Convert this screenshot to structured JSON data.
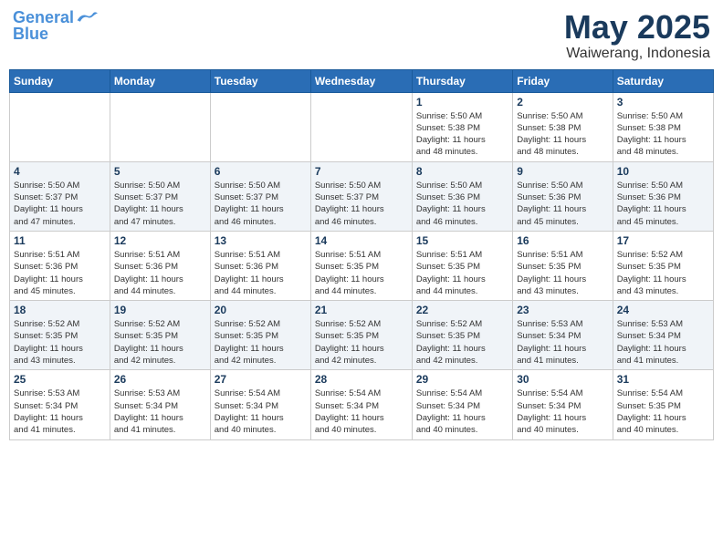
{
  "header": {
    "logo_line1": "General",
    "logo_line2": "Blue",
    "month": "May 2025",
    "location": "Waiwerang, Indonesia"
  },
  "weekdays": [
    "Sunday",
    "Monday",
    "Tuesday",
    "Wednesday",
    "Thursday",
    "Friday",
    "Saturday"
  ],
  "weeks": [
    [
      {
        "day": "",
        "info": ""
      },
      {
        "day": "",
        "info": ""
      },
      {
        "day": "",
        "info": ""
      },
      {
        "day": "",
        "info": ""
      },
      {
        "day": "1",
        "info": "Sunrise: 5:50 AM\nSunset: 5:38 PM\nDaylight: 11 hours\nand 48 minutes."
      },
      {
        "day": "2",
        "info": "Sunrise: 5:50 AM\nSunset: 5:38 PM\nDaylight: 11 hours\nand 48 minutes."
      },
      {
        "day": "3",
        "info": "Sunrise: 5:50 AM\nSunset: 5:38 PM\nDaylight: 11 hours\nand 48 minutes."
      }
    ],
    [
      {
        "day": "4",
        "info": "Sunrise: 5:50 AM\nSunset: 5:37 PM\nDaylight: 11 hours\nand 47 minutes."
      },
      {
        "day": "5",
        "info": "Sunrise: 5:50 AM\nSunset: 5:37 PM\nDaylight: 11 hours\nand 47 minutes."
      },
      {
        "day": "6",
        "info": "Sunrise: 5:50 AM\nSunset: 5:37 PM\nDaylight: 11 hours\nand 46 minutes."
      },
      {
        "day": "7",
        "info": "Sunrise: 5:50 AM\nSunset: 5:37 PM\nDaylight: 11 hours\nand 46 minutes."
      },
      {
        "day": "8",
        "info": "Sunrise: 5:50 AM\nSunset: 5:36 PM\nDaylight: 11 hours\nand 46 minutes."
      },
      {
        "day": "9",
        "info": "Sunrise: 5:50 AM\nSunset: 5:36 PM\nDaylight: 11 hours\nand 45 minutes."
      },
      {
        "day": "10",
        "info": "Sunrise: 5:50 AM\nSunset: 5:36 PM\nDaylight: 11 hours\nand 45 minutes."
      }
    ],
    [
      {
        "day": "11",
        "info": "Sunrise: 5:51 AM\nSunset: 5:36 PM\nDaylight: 11 hours\nand 45 minutes."
      },
      {
        "day": "12",
        "info": "Sunrise: 5:51 AM\nSunset: 5:36 PM\nDaylight: 11 hours\nand 44 minutes."
      },
      {
        "day": "13",
        "info": "Sunrise: 5:51 AM\nSunset: 5:36 PM\nDaylight: 11 hours\nand 44 minutes."
      },
      {
        "day": "14",
        "info": "Sunrise: 5:51 AM\nSunset: 5:35 PM\nDaylight: 11 hours\nand 44 minutes."
      },
      {
        "day": "15",
        "info": "Sunrise: 5:51 AM\nSunset: 5:35 PM\nDaylight: 11 hours\nand 44 minutes."
      },
      {
        "day": "16",
        "info": "Sunrise: 5:51 AM\nSunset: 5:35 PM\nDaylight: 11 hours\nand 43 minutes."
      },
      {
        "day": "17",
        "info": "Sunrise: 5:52 AM\nSunset: 5:35 PM\nDaylight: 11 hours\nand 43 minutes."
      }
    ],
    [
      {
        "day": "18",
        "info": "Sunrise: 5:52 AM\nSunset: 5:35 PM\nDaylight: 11 hours\nand 43 minutes."
      },
      {
        "day": "19",
        "info": "Sunrise: 5:52 AM\nSunset: 5:35 PM\nDaylight: 11 hours\nand 42 minutes."
      },
      {
        "day": "20",
        "info": "Sunrise: 5:52 AM\nSunset: 5:35 PM\nDaylight: 11 hours\nand 42 minutes."
      },
      {
        "day": "21",
        "info": "Sunrise: 5:52 AM\nSunset: 5:35 PM\nDaylight: 11 hours\nand 42 minutes."
      },
      {
        "day": "22",
        "info": "Sunrise: 5:52 AM\nSunset: 5:35 PM\nDaylight: 11 hours\nand 42 minutes."
      },
      {
        "day": "23",
        "info": "Sunrise: 5:53 AM\nSunset: 5:34 PM\nDaylight: 11 hours\nand 41 minutes."
      },
      {
        "day": "24",
        "info": "Sunrise: 5:53 AM\nSunset: 5:34 PM\nDaylight: 11 hours\nand 41 minutes."
      }
    ],
    [
      {
        "day": "25",
        "info": "Sunrise: 5:53 AM\nSunset: 5:34 PM\nDaylight: 11 hours\nand 41 minutes."
      },
      {
        "day": "26",
        "info": "Sunrise: 5:53 AM\nSunset: 5:34 PM\nDaylight: 11 hours\nand 41 minutes."
      },
      {
        "day": "27",
        "info": "Sunrise: 5:54 AM\nSunset: 5:34 PM\nDaylight: 11 hours\nand 40 minutes."
      },
      {
        "day": "28",
        "info": "Sunrise: 5:54 AM\nSunset: 5:34 PM\nDaylight: 11 hours\nand 40 minutes."
      },
      {
        "day": "29",
        "info": "Sunrise: 5:54 AM\nSunset: 5:34 PM\nDaylight: 11 hours\nand 40 minutes."
      },
      {
        "day": "30",
        "info": "Sunrise: 5:54 AM\nSunset: 5:34 PM\nDaylight: 11 hours\nand 40 minutes."
      },
      {
        "day": "31",
        "info": "Sunrise: 5:54 AM\nSunset: 5:35 PM\nDaylight: 11 hours\nand 40 minutes."
      }
    ]
  ]
}
